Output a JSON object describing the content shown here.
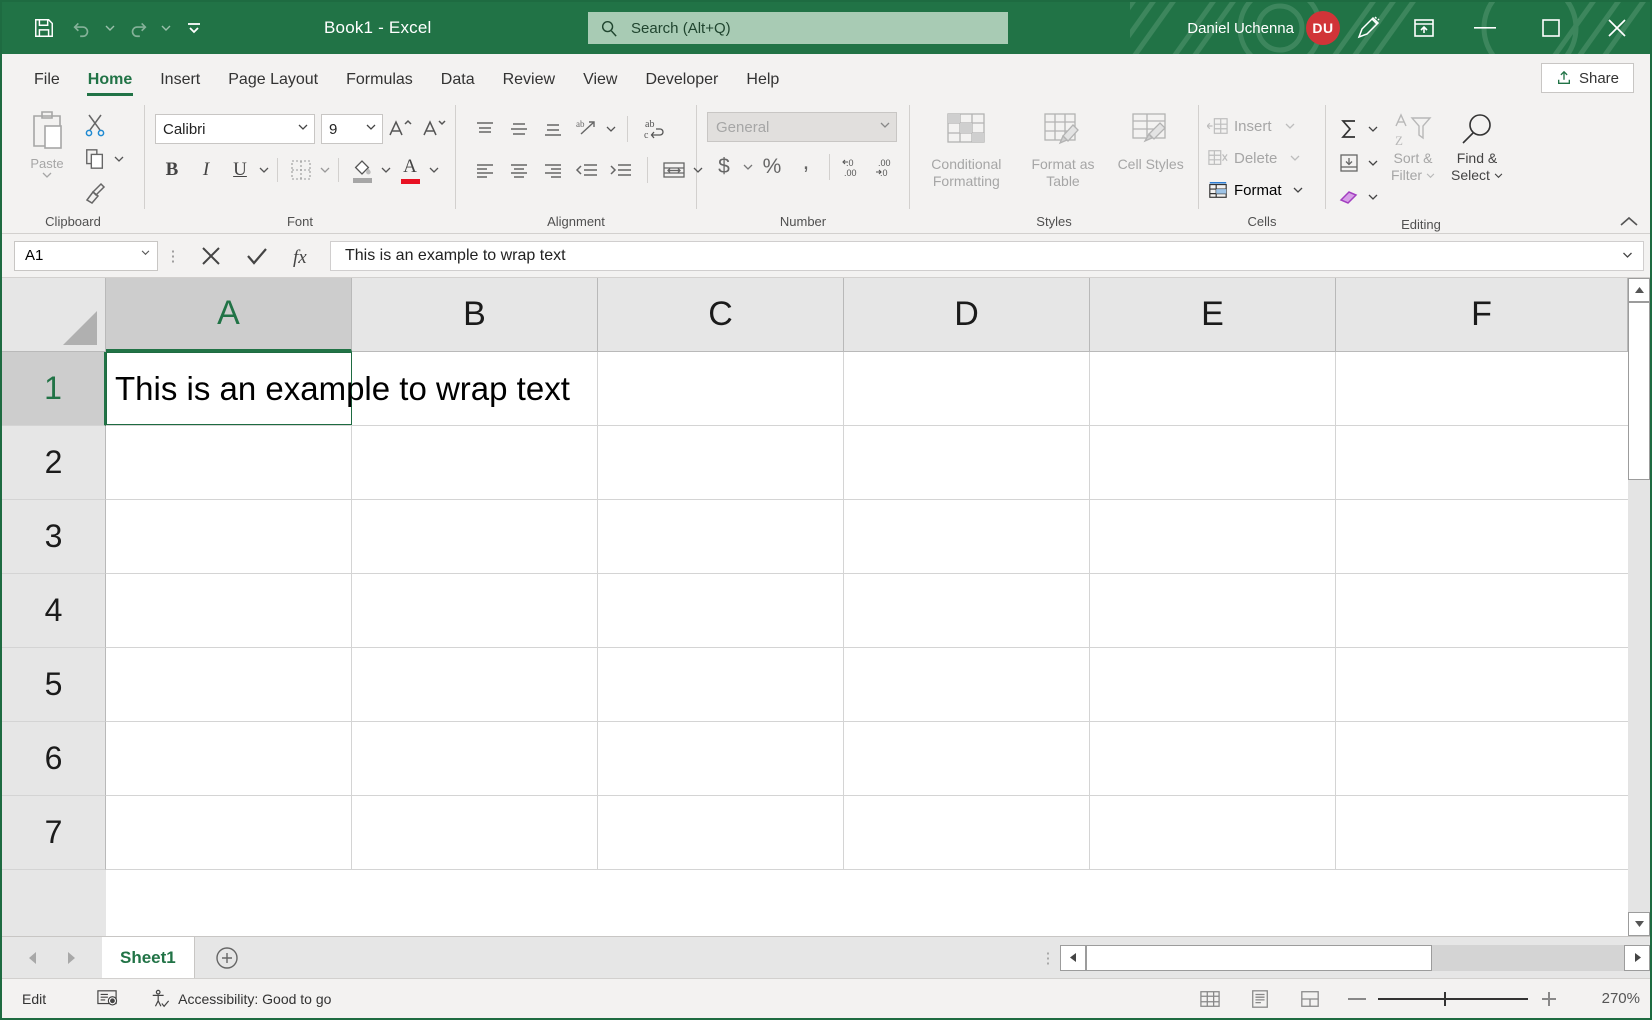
{
  "titlebar": {
    "save_label": "Save",
    "undo_label": "Undo",
    "redo_label": "Redo",
    "customize_qat_label": "Customize Quick Access Toolbar",
    "document_title": "Book1  -  Excel",
    "account_name": "Daniel Uchenna",
    "avatar_initials": "DU",
    "pen_label": "Pen / Ink",
    "ribbon_display_label": "Ribbon Display Options",
    "minimize_label": "Minimize",
    "maximize_label": "Restore Down",
    "close_label": "Close"
  },
  "search": {
    "placeholder": "Search (Alt+Q)",
    "icon": "search-icon"
  },
  "tabs": [
    {
      "label": "File",
      "active": false
    },
    {
      "label": "Home",
      "active": true
    },
    {
      "label": "Insert",
      "active": false
    },
    {
      "label": "Page Layout",
      "active": false
    },
    {
      "label": "Formulas",
      "active": false
    },
    {
      "label": "Data",
      "active": false
    },
    {
      "label": "Review",
      "active": false
    },
    {
      "label": "View",
      "active": false
    },
    {
      "label": "Developer",
      "active": false
    },
    {
      "label": "Help",
      "active": false
    }
  ],
  "share": {
    "label": "Share"
  },
  "ribbon": {
    "clipboard": {
      "group_label": "Clipboard",
      "paste_label": "Paste",
      "cut_label": "Cut",
      "copy_label": "Copy",
      "format_painter_label": "Format Painter"
    },
    "font": {
      "group_label": "Font",
      "font_name": "Calibri",
      "font_size": "9",
      "grow_font_label": "Increase Font Size",
      "shrink_font_label": "Decrease Font Size",
      "bold_label": "B",
      "italic_label": "I",
      "underline_label": "U",
      "borders_label": "Borders",
      "fill_color_label": "Fill Color",
      "font_color_label": "Font Color",
      "font_color_hex": "#e81123"
    },
    "alignment": {
      "group_label": "Alignment",
      "top_align_label": "Top Align",
      "middle_align_label": "Middle Align",
      "bottom_align_label": "Bottom Align",
      "orientation_label": "Orientation",
      "wrap_text_label": "Wrap Text",
      "align_left_label": "Align Left",
      "center_label": "Center",
      "align_right_label": "Align Right",
      "decrease_indent_label": "Decrease Indent",
      "increase_indent_label": "Increase Indent",
      "merge_center_label": "Merge & Center"
    },
    "number": {
      "group_label": "Number",
      "format_value": "General",
      "accounting_label": "Accounting Number Format",
      "percent_label": "Percent Style",
      "comma_label": "Comma Style",
      "increase_decimal_label": "Increase Decimal",
      "decrease_decimal_label": "Decrease Decimal"
    },
    "styles": {
      "group_label": "Styles",
      "conditional_formatting": "Conditional Formatting",
      "format_as_table": "Format as Table",
      "cell_styles": "Cell Styles"
    },
    "cells": {
      "group_label": "Cells",
      "insert_label": "Insert",
      "delete_label": "Delete",
      "format_label": "Format"
    },
    "editing": {
      "group_label": "Editing",
      "autosum_label": "AutoSum",
      "fill_label": "Fill",
      "clear_label": "Clear",
      "sort_filter_line1": "Sort &",
      "sort_filter_line2": "Filter",
      "find_select_line1": "Find &",
      "find_select_line2": "Select"
    },
    "collapse_label": "Collapse the Ribbon"
  },
  "formula_bar": {
    "name_box_value": "A1",
    "cancel_label": "Cancel",
    "enter_label": "Enter",
    "insert_function_label": "Insert Function",
    "formula_value": "This is an example to wrap text",
    "expand_label": "Expand Formula Bar"
  },
  "grid": {
    "columns": [
      "A",
      "B",
      "C",
      "D",
      "E",
      "F"
    ],
    "selected_column": "A",
    "rows": [
      "1",
      "2",
      "3",
      "4",
      "5",
      "6",
      "7"
    ],
    "selected_row": "1",
    "active_cell": "A1",
    "active_cell_value": "This is an example to wrap text",
    "select_all_label": "Select All"
  },
  "sheetbar": {
    "prev_label": "Previous Sheet",
    "next_label": "Next Sheet",
    "sheets": [
      {
        "name": "Sheet1",
        "active": true
      }
    ],
    "add_sheet_label": "New sheet"
  },
  "statusbar": {
    "mode": "Edit",
    "macro_label": "Record Macro",
    "accessibility": "Accessibility: Good to go",
    "normal_view_label": "Normal",
    "page_layout_label": "Page Layout",
    "page_break_label": "Page Break Preview",
    "zoom_out_label": "Zoom Out",
    "zoom_in_label": "Zoom In",
    "zoom_level": "270%"
  },
  "colors": {
    "brand_green": "#217346",
    "accent_red": "#d13438",
    "search_bg": "#a8cbb4",
    "ribbon_bg": "#f3f2f1"
  }
}
